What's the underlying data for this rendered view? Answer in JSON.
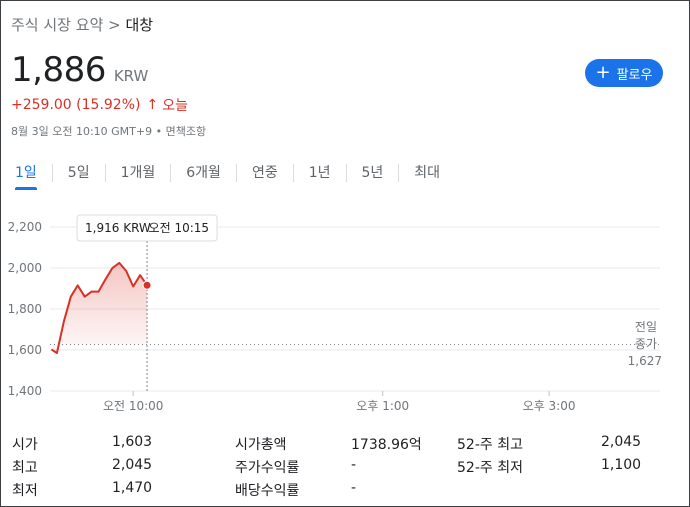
{
  "breadcrumb": {
    "root": "주식 시장 요약",
    "separator": ">",
    "current": "대창"
  },
  "quote": {
    "price": "1,886",
    "currency": "KRW",
    "change": "+259.00 (15.92%)",
    "change_arrow": "↑",
    "change_period": "오늘",
    "meta": "8월 3일 오전 10:10 GMT+9 • 면책조항"
  },
  "follow_button": {
    "label": "팔로우",
    "icon": "plus-icon"
  },
  "tabs": [
    {
      "label": "1일",
      "active": true
    },
    {
      "label": "5일"
    },
    {
      "label": "1개월"
    },
    {
      "label": "6개월"
    },
    {
      "label": "연중"
    },
    {
      "label": "1년"
    },
    {
      "label": "5년"
    },
    {
      "label": "최대"
    }
  ],
  "tooltip": {
    "value": "1,916 KRW",
    "time": "오전 10:15"
  },
  "colors": {
    "accent": "#1a73e8",
    "up": "#d93025",
    "grid": "#e8eaed",
    "text_muted": "#70757a"
  },
  "chart_data": {
    "type": "line",
    "y_ticks": [
      "2,200",
      "2,000",
      "1,800",
      "1,600",
      "1,400"
    ],
    "ylim": [
      1400,
      2200
    ],
    "x_ticks": [
      "오전 10:00",
      "오후 1:00",
      "오후 3:00"
    ],
    "x_tick_minutes": [
      0,
      180,
      300
    ],
    "xlim": [
      -60,
      380
    ],
    "x": [
      -59,
      -55,
      -50,
      -45,
      -40,
      -35,
      -30,
      -25,
      -20,
      -15,
      -10,
      -5,
      0,
      5,
      10
    ],
    "y": [
      1603,
      1585,
      1740,
      1860,
      1915,
      1860,
      1885,
      1885,
      1945,
      2000,
      2025,
      1985,
      1910,
      1965,
      1916
    ],
    "previous_close": {
      "label_line1": "전일",
      "label_line2": "종가",
      "value": 1627
    },
    "previous_close_text": "1,627",
    "grid": true
  },
  "stats": {
    "col1": [
      {
        "key": "시가",
        "value": "1,603"
      },
      {
        "key": "최고",
        "value": "2,045"
      },
      {
        "key": "최저",
        "value": "1,470"
      }
    ],
    "col2": [
      {
        "key": "시가총액",
        "value": "1738.96억"
      },
      {
        "key": "주가수익률",
        "value": "-"
      },
      {
        "key": "배당수익률",
        "value": "-"
      }
    ],
    "col3": [
      {
        "key": "52-주 최고",
        "value": "2,045"
      },
      {
        "key": "52-주 최저",
        "value": "1,100"
      }
    ]
  }
}
